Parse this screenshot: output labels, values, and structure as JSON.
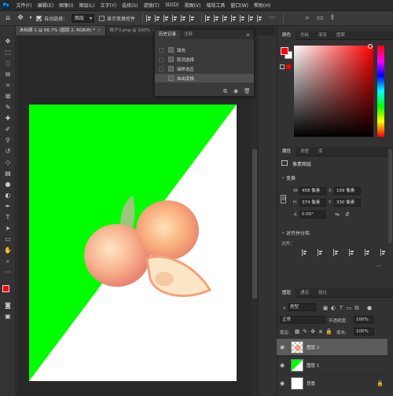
{
  "menubar": {
    "logo": "Ps",
    "items": [
      "文件(F)",
      "编辑(E)",
      "图像(I)",
      "图层(L)",
      "文字(Y)",
      "选择(S)",
      "滤镜(T)",
      "3D(D)",
      "视图(V)",
      "增效工具",
      "窗口(W)",
      "帮助(H)"
    ]
  },
  "options": {
    "auto_select_label": "自动选择：",
    "auto_select_value": "图层",
    "show_transform_label": "显示变换控件"
  },
  "tabs": [
    {
      "label": "未标题-1 @ 66.7% (图层 2, RGB/8) *",
      "active": true
    },
    {
      "label": "桃子3.png @ 100%",
      "active": false
    }
  ],
  "history": {
    "tabs": [
      "历史记录",
      "注释"
    ],
    "items": [
      {
        "label": "填充",
        "active": false
      },
      {
        "label": "取消选择",
        "active": false
      },
      {
        "label": "描移选区",
        "active": false
      },
      {
        "label": "自由变换",
        "active": true
      }
    ]
  },
  "color_panel": {
    "tabs": [
      "颜色",
      "色板",
      "渐变",
      "图案"
    ],
    "foreground": "#ff0000",
    "background": "#ffffff"
  },
  "properties": {
    "tabs": [
      "属性",
      "调整",
      "库"
    ],
    "layer_type": "像素图层",
    "transform_title": "变换",
    "w_label": "W",
    "w_value": "458 像素",
    "x_label": "X",
    "x_value": "199 像素",
    "h_label": "H",
    "h_value": "374 像素",
    "y_label": "Y",
    "y_value": "330 像素",
    "angle_value": "0.00°",
    "align_title": "对齐并分布",
    "align_label": "对齐："
  },
  "layers": {
    "tabs": [
      "图层",
      "通道",
      "路径"
    ],
    "filter_kind": "类型",
    "blend_mode": "正常",
    "opacity_label": "不透明度:",
    "opacity_value": "100%",
    "lock_label": "锁定:",
    "fill_label": "填充:",
    "fill_value": "100%",
    "rows": [
      {
        "name": "图层 2",
        "active": true
      },
      {
        "name": "图层 1",
        "active": false
      },
      {
        "name": "背景",
        "active": false
      }
    ]
  },
  "colors": {
    "green_fill": "#00ff00",
    "accent_blue": "#31a8ff"
  }
}
